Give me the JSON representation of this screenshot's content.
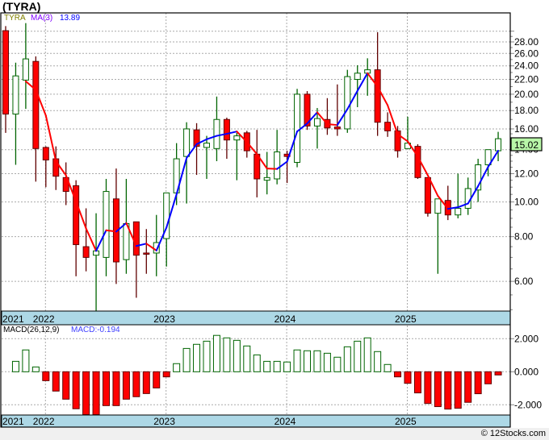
{
  "title": "(TYRA)",
  "footer": "© 12Stocks.com",
  "legend": {
    "symbol": "TYRA",
    "ma_label": "MA(3)",
    "ma_value": "13.89"
  },
  "macd_legend": {
    "label": "MACD(26,12,9)",
    "value": "MACD:-0.194"
  },
  "current_price": "15.02",
  "colors": {
    "up": "#006400",
    "down": "#ff0000",
    "down_edge": "#600000",
    "ma_up": "#0000ff",
    "ma_down": "#ff0000",
    "date_band": "#add8e6"
  },
  "chart_data": [
    {
      "type": "candlestick",
      "title": "(TYRA)",
      "scale": "log",
      "ylim": [
        4.6,
        33
      ],
      "y_ticks": [
        "6.00",
        "8.00",
        "10.00",
        "12.00",
        "14.00",
        "16.00",
        "18.00",
        "20.00",
        "22.00",
        "24.00",
        "26.00",
        "28.00"
      ],
      "x_ticks": [
        "2021",
        "2022",
        "2023",
        "2024",
        "2025"
      ],
      "grid": true,
      "dates": [
        "2021-09",
        "2021-10",
        "2021-11",
        "2021-12",
        "2022-01",
        "2022-02",
        "2022-03",
        "2022-04",
        "2022-05",
        "2022-06",
        "2022-07",
        "2022-08",
        "2022-09",
        "2022-10",
        "2022-11",
        "2022-12",
        "2023-01",
        "2023-02",
        "2023-03",
        "2023-04",
        "2023-05",
        "2023-06",
        "2023-07",
        "2023-08",
        "2023-09",
        "2023-10",
        "2023-11",
        "2023-12",
        "2024-01",
        "2024-02",
        "2024-03",
        "2024-04",
        "2024-05",
        "2024-06",
        "2024-07",
        "2024-08",
        "2024-09",
        "2024-10",
        "2024-11",
        "2024-12",
        "2025-01",
        "2025-02",
        "2025-03",
        "2025-04",
        "2025-05",
        "2025-06",
        "2025-07",
        "2025-08",
        "2025-09",
        "2025-10"
      ],
      "ohlc": [
        [
          30.1,
          31.0,
          15.6,
          17.6
        ],
        [
          17.6,
          24.5,
          12.7,
          22.5
        ],
        [
          21.9,
          31.6,
          18.2,
          25.1
        ],
        [
          24.7,
          25.5,
          11.4,
          14.1
        ],
        [
          14.2,
          14.3,
          11.0,
          13.1
        ],
        [
          13.2,
          14.3,
          10.8,
          11.8
        ],
        [
          11.7,
          12.9,
          9.8,
          10.7
        ],
        [
          11.1,
          11.5,
          6.2,
          7.6
        ],
        [
          7.5,
          9.6,
          6.4,
          7.0
        ],
        [
          7.1,
          9.3,
          4.6,
          7.3
        ],
        [
          7.0,
          11.6,
          6.2,
          10.7
        ],
        [
          10.2,
          12.4,
          5.9,
          6.8
        ],
        [
          6.9,
          11.6,
          6.3,
          8.7
        ],
        [
          8.8,
          8.8,
          5.4,
          7.1
        ],
        [
          7.2,
          8.4,
          6.3,
          7.15
        ],
        [
          7.2,
          9.2,
          6.2,
          7.7
        ],
        [
          7.9,
          10.6,
          6.6,
          10.6
        ],
        [
          10.6,
          14.6,
          9.8,
          13.2
        ],
        [
          13.4,
          16.7,
          9.9,
          16.0
        ],
        [
          15.9,
          16.6,
          11.9,
          14.3
        ],
        [
          14.2,
          15.3,
          11.6,
          14.6
        ],
        [
          14.1,
          19.7,
          13.0,
          17.0
        ],
        [
          17.0,
          17.2,
          13.2,
          14.9
        ],
        [
          14.9,
          15.6,
          11.5,
          15.3
        ],
        [
          15.6,
          15.8,
          13.3,
          13.9
        ],
        [
          13.6,
          15.9,
          10.3,
          11.6
        ],
        [
          11.5,
          13.8,
          10.5,
          11.7
        ],
        [
          11.6,
          15.9,
          11.2,
          13.8
        ],
        [
          13.6,
          13.9,
          11.3,
          13.4
        ],
        [
          12.9,
          20.7,
          12.5,
          20.0
        ],
        [
          20.0,
          20.4,
          15.9,
          16.3
        ],
        [
          16.3,
          18.3,
          14.1,
          17.1
        ],
        [
          17.0,
          19.5,
          15.4,
          16.1
        ],
        [
          16.2,
          21.3,
          15.3,
          16.0
        ],
        [
          16.0,
          23.4,
          15.6,
          22.4
        ],
        [
          22.0,
          24.1,
          18.4,
          22.9
        ],
        [
          22.9,
          25.2,
          19.8,
          23.4
        ],
        [
          23.4,
          29.8,
          15.3,
          16.7
        ],
        [
          16.7,
          17.8,
          15.2,
          15.8
        ],
        [
          15.8,
          16.3,
          13.3,
          13.9
        ],
        [
          14.1,
          17.3,
          14.1,
          14.6
        ],
        [
          14.3,
          14.5,
          11.6,
          11.7
        ],
        [
          11.7,
          11.7,
          9.1,
          9.3
        ],
        [
          9.3,
          10.2,
          6.3,
          10.2
        ],
        [
          10.1,
          11.1,
          8.9,
          9.2
        ],
        [
          9.2,
          12.0,
          9.0,
          9.6
        ],
        [
          9.6,
          11.7,
          9.2,
          10.9
        ],
        [
          10.8,
          13.2,
          10.0,
          12.7
        ],
        [
          12.7,
          14.0,
          11.8,
          14.0
        ],
        [
          13.9,
          15.7,
          13.0,
          15.02
        ]
      ],
      "ma_period": 3
    },
    {
      "type": "bar",
      "title": "MACD(26,12,9)",
      "ylim": [
        -2.7,
        2.7
      ],
      "y_ticks": [
        "2.000",
        "0.000",
        "-2.000"
      ],
      "dates": [
        "2021-10",
        "2021-11",
        "2021-12",
        "2022-01",
        "2022-02",
        "2022-03",
        "2022-04",
        "2022-05",
        "2022-06",
        "2022-07",
        "2022-08",
        "2022-09",
        "2022-10",
        "2022-11",
        "2022-12",
        "2023-01",
        "2023-02",
        "2023-03",
        "2023-04",
        "2023-05",
        "2023-06",
        "2023-07",
        "2023-08",
        "2023-09",
        "2023-10",
        "2023-11",
        "2023-12",
        "2024-01",
        "2024-02",
        "2024-03",
        "2024-04",
        "2024-05",
        "2024-06",
        "2024-07",
        "2024-08",
        "2024-09",
        "2024-10",
        "2024-11",
        "2024-12",
        "2025-01",
        "2025-02",
        "2025-03",
        "2025-04",
        "2025-05",
        "2025-06",
        "2025-07",
        "2025-08",
        "2025-09",
        "2025-10"
      ],
      "values": [
        0.63,
        1.32,
        0.29,
        -0.54,
        -1.17,
        -1.66,
        -2.24,
        -2.6,
        -2.6,
        -2.05,
        -2.05,
        -1.66,
        -1.51,
        -1.32,
        -0.98,
        -0.31,
        0.49,
        1.41,
        1.66,
        1.85,
        2.2,
        2.05,
        1.9,
        1.56,
        1.02,
        0.63,
        0.63,
        0.59,
        1.32,
        1.27,
        1.27,
        1.12,
        0.88,
        1.51,
        1.85,
        2.05,
        1.22,
        0.44,
        -0.31,
        -0.7,
        -1.28,
        -1.92,
        -2.11,
        -2.26,
        -2.21,
        -1.85,
        -1.33,
        -0.73,
        -0.194
      ]
    }
  ]
}
